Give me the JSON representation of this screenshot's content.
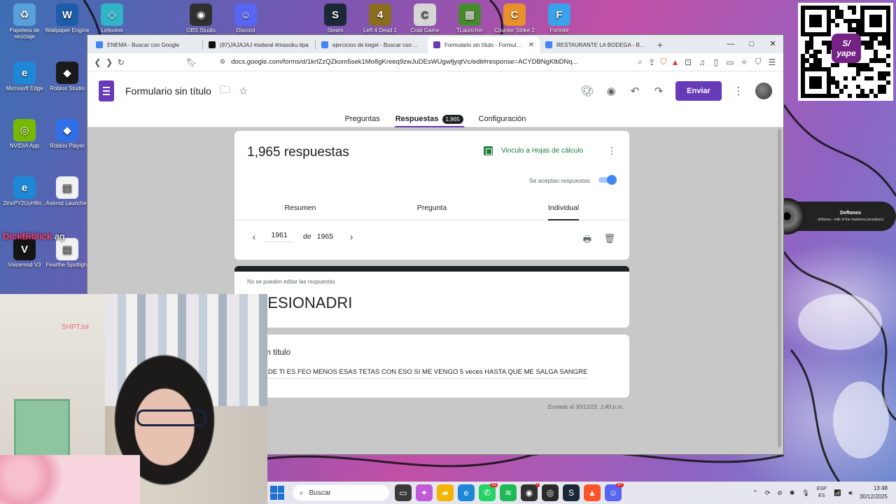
{
  "desktop": {
    "icons": [
      {
        "label": "Papelera de reciclaje",
        "color": "#5aa0d8",
        "glyph": "♻"
      },
      {
        "label": "Wallpaper Engine",
        "color": "#1d5da8",
        "glyph": "W"
      },
      {
        "label": "Letsview",
        "color": "#2fb4c8",
        "glyph": "◇"
      },
      {
        "label": "OBS Studio",
        "color": "#303030",
        "glyph": "◉"
      },
      {
        "label": "Discord",
        "color": "#5865f2",
        "glyph": "☺"
      },
      {
        "label": "Steam",
        "color": "#1b2838",
        "glyph": "S"
      },
      {
        "label": "Left 4 Dead 2",
        "color": "#8a6d1f",
        "glyph": "4"
      },
      {
        "label": "Crab Game",
        "color": "#d6d6d6",
        "glyph": "C"
      },
      {
        "label": "TLauncher",
        "color": "#4a8a2e",
        "glyph": "▦"
      },
      {
        "label": "Counter Strike 2",
        "color": "#e8912b",
        "glyph": "C"
      },
      {
        "label": "Fortnite",
        "color": "#3aa2e8",
        "glyph": "F"
      },
      {
        "label": "Microsoft Edge",
        "color": "#1e88d6",
        "glyph": "e"
      },
      {
        "label": "Roblox Studio",
        "color": "#1a1a1a",
        "glyph": "◆"
      },
      {
        "label": "NVIDIA App",
        "color": "#76b900",
        "glyph": "◎"
      },
      {
        "label": "Roblox Player",
        "color": "#2f6fe8",
        "glyph": "◆"
      },
      {
        "label": "2inxPY2UyH8ri...",
        "color": "#1e88d6",
        "glyph": "e"
      },
      {
        "label": "Axerod Launcher",
        "color": "#f1f1f1",
        "glyph": "▤"
      },
      {
        "label": "Voicemod V3",
        "color": "#141414",
        "glyph": "V"
      },
      {
        "label": "Fearthe Spotlight",
        "color": "#f1f1f1",
        "glyph": "▤"
      }
    ],
    "overlay_name": "DickBiblick",
    "overlay_suffix": " ag",
    "cam_overlay_text": "SHPT.tol"
  },
  "qr": {
    "brand": "yape",
    "symbol": "S/"
  },
  "music_widget": {
    "artist": "Deftones",
    "song": "deftones - milk of the madonna [visualizer]"
  },
  "browser": {
    "tabs": [
      {
        "title": "ENEMA - Buscar con Google",
        "icon_color": "#4285f4",
        "active": false
      },
      {
        "title": "(97)JAJAJAJ #sideral #masoku #pa",
        "icon_color": "#111111",
        "active": false
      },
      {
        "title": "ejercicios de kegel - Buscar con Goo",
        "icon_color": "#4285f4",
        "active": false
      },
      {
        "title": "Formulario sin título - Formulario",
        "icon_color": "#673ab7",
        "active": true
      },
      {
        "title": "RESTAURANTE LA BODEGA - Buscar",
        "icon_color": "#4285f4",
        "active": false
      }
    ],
    "new_tab": "+",
    "window_controls": [
      "—",
      "□",
      "✕"
    ],
    "url": "docs.google.com/forms/d/1krfZzQZkom5sek1Mo8gKreeq9zwJuDEsWUgwfjyqtVc/edit#response=ACYDBNgKlbDNq..."
  },
  "forms": {
    "title": "Formulario sin título",
    "send_label": "Enviar",
    "tabs": {
      "questions": "Preguntas",
      "responses": "Respuestas",
      "responses_count": "1,965",
      "settings": "Configuración"
    },
    "summary": {
      "count_label": "1,965 respuestas",
      "sheets_link": "Vinculo a Hojas de cálculo",
      "accepting": "Se aceptan respuestas",
      "accepting_on": true,
      "subtabs": [
        "Resumen",
        "Pregunta",
        "Individual"
      ],
      "active_subtab": "Individual"
    },
    "pager": {
      "current": "1961",
      "of": "de",
      "total": "1965"
    },
    "response": {
      "no_edit": "No se pueden editar las respuestas",
      "form_heading": "NFESIONADRI",
      "question_title": "nta sin título",
      "answer": "TODO DE TI ES FEO MENOS ESAS TETAS CON ESO SI ME VENGO 5 veces HASTA QUE ME SALGA SANGRE",
      "sent": "Enviado el 30/12/25, 1:40 p.m."
    }
  },
  "taskbar": {
    "search_placeholder": "Buscar",
    "apps": [
      {
        "name": "task-view",
        "color": "#3a3a3a",
        "glyph": "▭",
        "badge": ""
      },
      {
        "name": "copilot",
        "color": "#c25bd8",
        "glyph": "✦",
        "badge": ""
      },
      {
        "name": "file-explorer",
        "color": "#f4b400",
        "glyph": "▰",
        "badge": ""
      },
      {
        "name": "edge",
        "color": "#1e88d6",
        "glyph": "e",
        "badge": ""
      },
      {
        "name": "whatsapp",
        "color": "#25d366",
        "glyph": "✆",
        "badge": "65"
      },
      {
        "name": "spotify",
        "color": "#1db954",
        "glyph": "≋",
        "badge": ""
      },
      {
        "name": "obs",
        "color": "#303030",
        "glyph": "◉",
        "badge": "•"
      },
      {
        "name": "xbox",
        "color": "#2a2a2a",
        "glyph": "◎",
        "badge": ""
      },
      {
        "name": "steam",
        "color": "#1b2838",
        "glyph": "S",
        "badge": ""
      },
      {
        "name": "brave",
        "color": "#fb542b",
        "glyph": "▲",
        "badge": ""
      },
      {
        "name": "discord",
        "color": "#5865f2",
        "glyph": "☺",
        "badge": "9+"
      }
    ],
    "lang_line1": "ESP",
    "lang_line2": "ES",
    "time": "13:48",
    "date": "30/12/2025"
  }
}
